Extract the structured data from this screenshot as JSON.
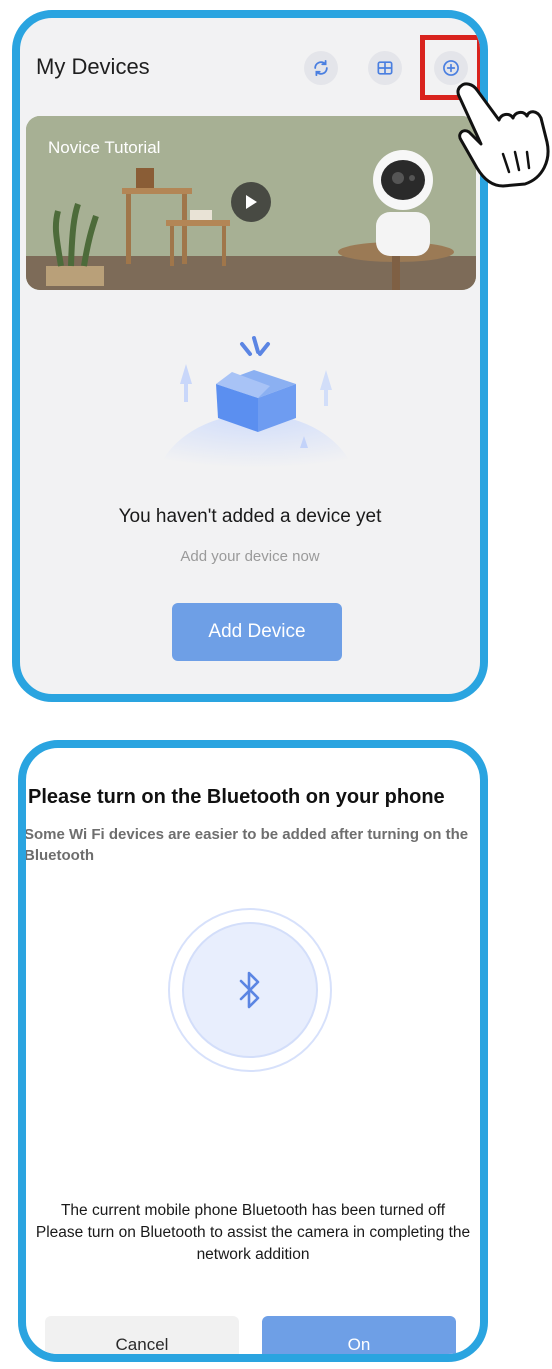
{
  "devices_screen": {
    "title": "My Devices",
    "icons": [
      "refresh-icon",
      "grid-view-icon",
      "add-circle-icon"
    ],
    "banner": {
      "title": "Novice Tutorial"
    },
    "empty_state": {
      "title": "You haven't added a device yet",
      "subtitle": "Add your device now",
      "button_label": "Add Device"
    }
  },
  "bluetooth_dialog": {
    "title": "Please turn on the Bluetooth on your phone",
    "description": "Some Wi Fi devices are easier to be added after turning on the Bluetooth",
    "message_line1": "The current mobile phone Bluetooth has been turned off",
    "message_line2": "Please turn on Bluetooth to assist the camera in completing the network addition",
    "cancel_label": "Cancel",
    "on_label": "On"
  },
  "colors": {
    "frame_border": "#2aa4e0",
    "primary_button": "#6e9fe6",
    "highlight_box": "#d9231e",
    "bluetooth_icon": "#5b85e3"
  }
}
